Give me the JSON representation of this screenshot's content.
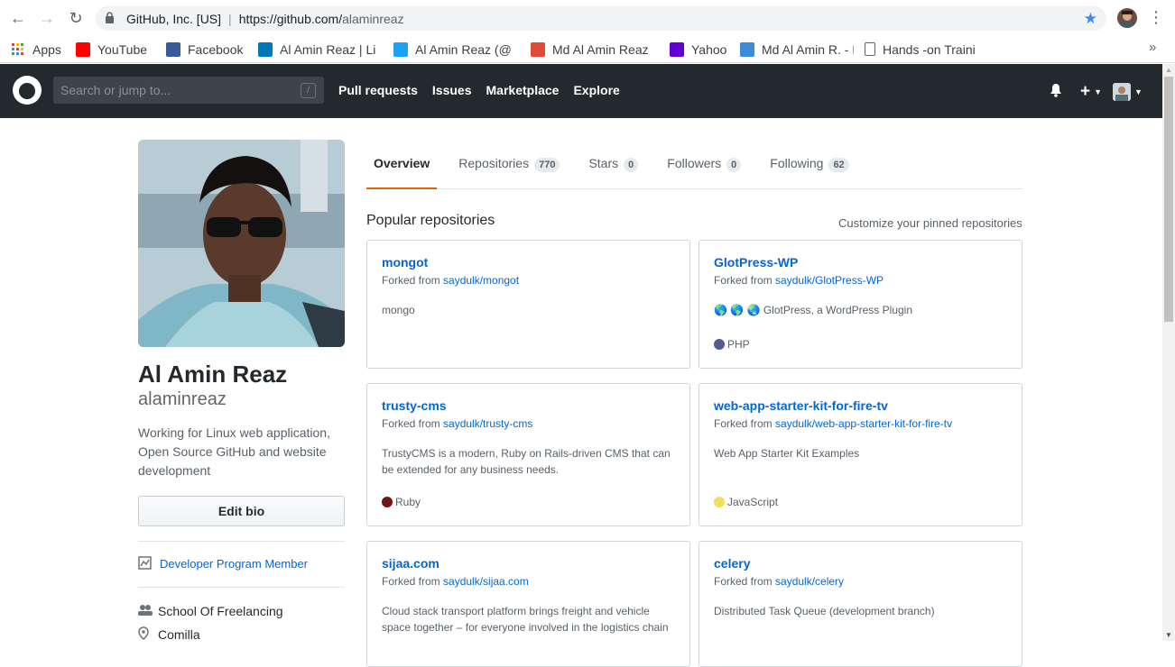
{
  "browser": {
    "org": "GitHub, Inc. [US]",
    "url_base": "https://github.com/",
    "url_path": "alaminreaz"
  },
  "bookmarks": [
    {
      "label": "Apps",
      "icon": "apps-grid-icon",
      "color": "#ea4335"
    },
    {
      "label": "YouTube",
      "icon": "youtube-icon",
      "color": "#ff0000"
    },
    {
      "label": "Facebook",
      "icon": "facebook-icon",
      "color": "#3b5998"
    },
    {
      "label": "Al Amin Reaz | Li",
      "icon": "linkedin-icon",
      "color": "#0077b5"
    },
    {
      "label": "Al Amin Reaz (@",
      "icon": "twitter-icon",
      "color": "#1da1f2"
    },
    {
      "label": "Md Al Amin Reaz",
      "icon": "google-plus-icon",
      "color": "#dd4b39"
    },
    {
      "label": "Yahoo",
      "icon": "yahoo-icon",
      "color": "#6001d2"
    },
    {
      "label": "Md Al Amin R. - L",
      "icon": "upwork-icon",
      "color": "#3a8bd9"
    },
    {
      "label": "Hands -on Traini",
      "icon": "page-icon",
      "color": "#ffffff"
    }
  ],
  "github": {
    "search_placeholder": "Search or jump to...",
    "slash_key": "/",
    "nav": [
      "Pull requests",
      "Issues",
      "Marketplace",
      "Explore"
    ]
  },
  "profile": {
    "fullname": "Al Amin Reaz",
    "username": "alaminreaz",
    "bio": "Working for Linux web application, Open Source GitHub and website development",
    "edit_bio": "Edit bio",
    "developer_program": "Developer Program Member",
    "organization": "School Of Freelancing",
    "location": "Comilla"
  },
  "tabs": [
    {
      "label": "Overview",
      "count": null
    },
    {
      "label": "Repositories",
      "count": "770"
    },
    {
      "label": "Stars",
      "count": "0"
    },
    {
      "label": "Followers",
      "count": "0"
    },
    {
      "label": "Following",
      "count": "62"
    }
  ],
  "popular": {
    "title": "Popular repositories",
    "customize": "Customize your pinned repositories"
  },
  "forked_prefix": "Forked from ",
  "repos": [
    {
      "name": "mongot",
      "fork": "saydulk/mongot",
      "desc": "mongo",
      "lang": "",
      "lang_color": ""
    },
    {
      "name": "GlotPress-WP",
      "fork": "saydulk/GlotPress-WP",
      "desc": "🌎 🌎 🌏 GlotPress, a WordPress Plugin",
      "lang": "PHP",
      "lang_color": "#4f5d95"
    },
    {
      "name": "trusty-cms",
      "fork": "saydulk/trusty-cms",
      "desc": "TrustyCMS is a modern, Ruby on Rails-driven CMS that can be extended for any business needs.",
      "lang": "Ruby",
      "lang_color": "#701516"
    },
    {
      "name": "web-app-starter-kit-for-fire-tv",
      "fork": "saydulk/web-app-starter-kit-for-fire-tv",
      "desc": "Web App Starter Kit Examples",
      "lang": "JavaScript",
      "lang_color": "#f1e05a"
    },
    {
      "name": "sijaa.com",
      "fork": "saydulk/sijaa.com",
      "desc": "Cloud stack transport platform brings freight and vehicle space together – for everyone involved in the logistics chain",
      "lang": "",
      "lang_color": ""
    },
    {
      "name": "celery",
      "fork": "saydulk/celery",
      "desc": "Distributed Task Queue (development branch)",
      "lang": "",
      "lang_color": ""
    }
  ]
}
